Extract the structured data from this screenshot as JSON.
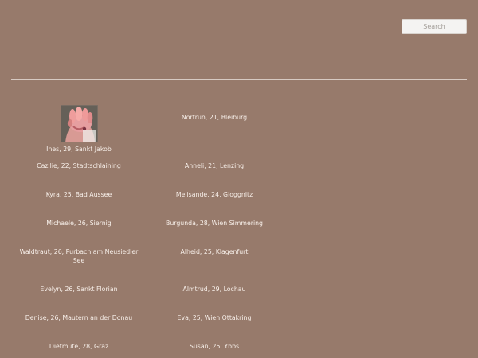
{
  "search": {
    "placeholder": "Search"
  },
  "profiles": [
    {
      "left": "Ines, 29, Sankt Jakob",
      "right": "Nortrun, 21, Bleiburg",
      "left_has_avatar": true
    },
    {
      "left": "Cazilie, 22, Stadtschlaining",
      "right": "Anneli, 21, Lenzing"
    },
    {
      "left": "Kyra, 25, Bad Aussee",
      "right": "Melisande, 24, Gloggnitz"
    },
    {
      "left": "Michaele, 26, Siernig",
      "right": "Burgunda, 28, Wien Simmering"
    },
    {
      "left": "Waldtraut, 26, Purbach am Neusiedler See",
      "right": "Alheid, 25, Klagenfurt"
    },
    {
      "left": "Evelyn, 26, Sankt Florian",
      "right": "Almtrud, 29, Lochau"
    },
    {
      "left": "Denise, 26, Mautern an der Donau",
      "right": "Eva, 25, Wien Ottakring"
    },
    {
      "left": "Dietmute, 28, Graz",
      "right": "Susan, 25, Ybbs"
    }
  ],
  "colors": {
    "background": "#977a6b",
    "text": "#f7efe9",
    "divider": "#d7cac2"
  },
  "icons": {
    "avatar": "profile-photo-fist"
  }
}
